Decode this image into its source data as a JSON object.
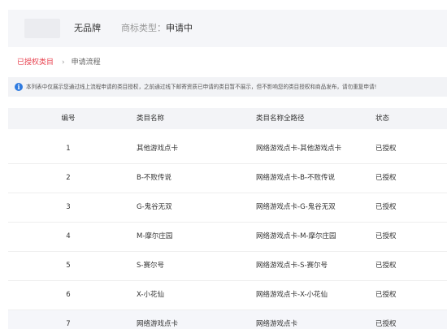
{
  "brand": {
    "name": "无品牌",
    "type_label": "商标类型：",
    "type_value": "申请中"
  },
  "tabs": [
    {
      "label": "已授权类目",
      "active": true
    },
    {
      "label": "申请流程",
      "active": false
    }
  ],
  "tab_separator": "›",
  "notice": {
    "icon": "info-icon",
    "icon_glyph": "i",
    "text": "本列表中仅展示您通过线上流程申请的类目授权，之前通过线下邮寄资质已申请的类目暂不展示，但不影响您的类目授权和商品发布，请勿重复申请!"
  },
  "table": {
    "headers": [
      "编号",
      "类目名称",
      "类目名称全路径",
      "状态"
    ],
    "rows": [
      {
        "num": "1",
        "name": "其他游戏点卡",
        "path": "网络游戏点卡-其他游戏点卡",
        "status": "已授权"
      },
      {
        "num": "2",
        "name": "B-不败传说",
        "path": "网络游戏点卡-B-不败传说",
        "status": "已授权"
      },
      {
        "num": "3",
        "name": "G-鬼谷无双",
        "path": "网络游戏点卡-G-鬼谷无双",
        "status": "已授权"
      },
      {
        "num": "4",
        "name": "M-摩尔庄园",
        "path": "网络游戏点卡-M-摩尔庄园",
        "status": "已授权"
      },
      {
        "num": "5",
        "name": "S-赛尔号",
        "path": "网络游戏点卡-S-赛尔号",
        "status": "已授权"
      },
      {
        "num": "6",
        "name": "X-小花仙",
        "path": "网络游戏点卡-X-小花仙",
        "status": "已授权"
      },
      {
        "num": "7",
        "name": "网络游戏点卡",
        "path": "网络游戏点卡",
        "status": "已授权"
      }
    ]
  },
  "colors": {
    "accent": "#e8424f",
    "info": "#2f7be0",
    "panel_bg": "#f5f6f9"
  }
}
